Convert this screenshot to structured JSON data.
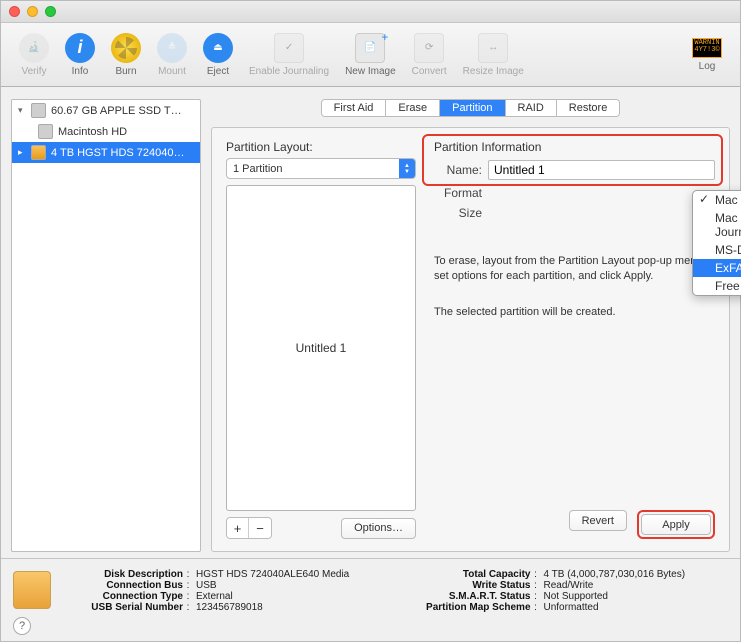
{
  "toolbar": {
    "items": [
      "Verify",
      "Info",
      "Burn",
      "Mount",
      "Eject",
      "Enable Journaling",
      "New Image",
      "Convert",
      "Resize Image"
    ],
    "log": "Log",
    "log_badge": "WARNING"
  },
  "sidebar": {
    "items": [
      {
        "label": "60.67 GB APPLE SSD T…"
      },
      {
        "label": "Macintosh HD"
      },
      {
        "label": "4 TB HGST HDS 724040…"
      }
    ]
  },
  "tabs": {
    "items": [
      "First Aid",
      "Erase",
      "Partition",
      "RAID",
      "Restore"
    ],
    "active": 2
  },
  "layout": {
    "title": "Partition Layout:",
    "select": "1 Partition",
    "partition_name": "Untitled 1",
    "plus": "+",
    "minus": "−",
    "options_btn": "Options…"
  },
  "info": {
    "title": "Partition Information",
    "name_label": "Name:",
    "name_value": "Untitled 1",
    "format_label": "Format",
    "size_label": "Size",
    "dropdown": [
      "Mac OS Extended (Journaled)",
      "Mac OS Extended (Case-sensitive, Journaled)",
      "MS-DOS (FAT)",
      "ExFAT",
      "Free Space"
    ],
    "checked": 0,
    "highlighted": 3,
    "instruction": "To erase, layout from the Partition Layout pop-up menu, set options for each partition, and click Apply.",
    "created_msg": "The selected partition will be created.",
    "revert_btn": "Revert",
    "apply_btn": "Apply"
  },
  "footer": {
    "left": [
      {
        "k": "Disk Description",
        "v": "HGST HDS 724040ALE640 Media"
      },
      {
        "k": "Connection Bus",
        "v": "USB"
      },
      {
        "k": "Connection Type",
        "v": "External"
      },
      {
        "k": "USB Serial Number",
        "v": "123456789018"
      }
    ],
    "right": [
      {
        "k": "Total Capacity",
        "v": "4 TB (4,000,787,030,016 Bytes)"
      },
      {
        "k": "Write Status",
        "v": "Read/Write"
      },
      {
        "k": "S.M.A.R.T. Status",
        "v": "Not Supported"
      },
      {
        "k": "Partition Map Scheme",
        "v": "Unformatted"
      }
    ]
  }
}
